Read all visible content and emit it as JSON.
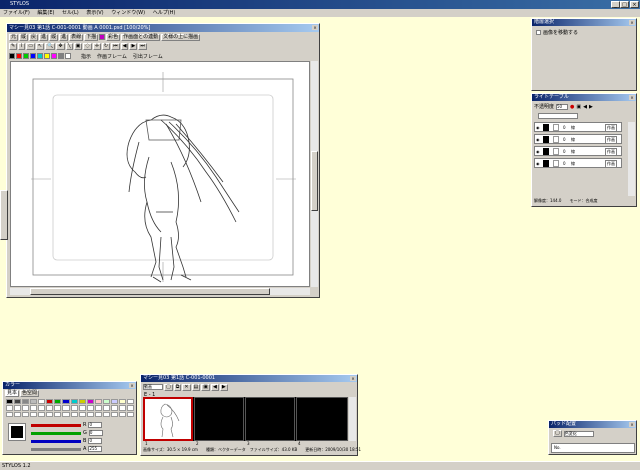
{
  "app": {
    "title": "STYLOS"
  },
  "window_controls": {
    "min": "_",
    "max": "□",
    "close": "×"
  },
  "menu": [
    "ファイル(F)",
    "編集(E)",
    "セル(L)",
    "表示(V)",
    "ウィンドウ(W)",
    "ヘルプ(H)"
  ],
  "status": {
    "text": "STYLOS 1.2"
  },
  "main_window": {
    "title": "マシー見03 第1話 C-001-0001 動画 A 0001.psd [100/20%]",
    "toolbar1": [
      "元",
      "縦",
      "戻",
      "進",
      "縦",
      "進",
      "表線",
      "下描",
      "彩色",
      "作画面との連動",
      "文様の上に描画"
    ],
    "toolbar2_labels": [
      "指示",
      "作画フレーム",
      "引出フレーム"
    ],
    "palette_colors": [
      "#000000",
      "#ff0000",
      "#00c000",
      "#0000ff",
      "#00c0c0",
      "#ffff00",
      "#ff00ff",
      "#808080",
      "#ffffff"
    ]
  },
  "layer_select": {
    "title": "階層選択",
    "checkbox_label": "画像を移動する"
  },
  "light_table": {
    "title": "ライトテーブル",
    "opacity_label": "不透明度",
    "opacity_value": "50",
    "rows": [
      {
        "num": "0",
        "opts": "線",
        "mode": "作画"
      },
      {
        "num": "0",
        "opts": "線",
        "mode": "作画"
      },
      {
        "num": "0",
        "opts": "線",
        "mode": "作画"
      },
      {
        "num": "0",
        "opts": "線",
        "mode": "作画"
      }
    ],
    "footer_res": "解像度：144.0",
    "footer_mode": "モード：合成度"
  },
  "color_panel": {
    "title": "カラー",
    "tabs": [
      "見本",
      "色空間"
    ],
    "sliders": [
      {
        "label": "R",
        "value": "0",
        "color": "#c00000"
      },
      {
        "label": "G",
        "value": "0",
        "color": "#00a000"
      },
      {
        "label": "B",
        "value": "0",
        "color": "#0000c0"
      },
      {
        "label": "A",
        "value": "255",
        "color": "#808080"
      }
    ]
  },
  "timeline": {
    "title": "マシー見03 第1話 C-001-0001",
    "cut_label": "動画",
    "row_label": "E - 1",
    "frame_nums": [
      "1",
      "2",
      "3",
      "4"
    ],
    "status": "画像サイズ：30.5 × 19.9 cm　　種類：ベクターデータ　ファイルサイズ：43.0 KB　　更新日時：2009/10/30 18:51"
  },
  "pad_panel": {
    "title": "パッド配置",
    "label": "色変化",
    "sub": "No."
  }
}
